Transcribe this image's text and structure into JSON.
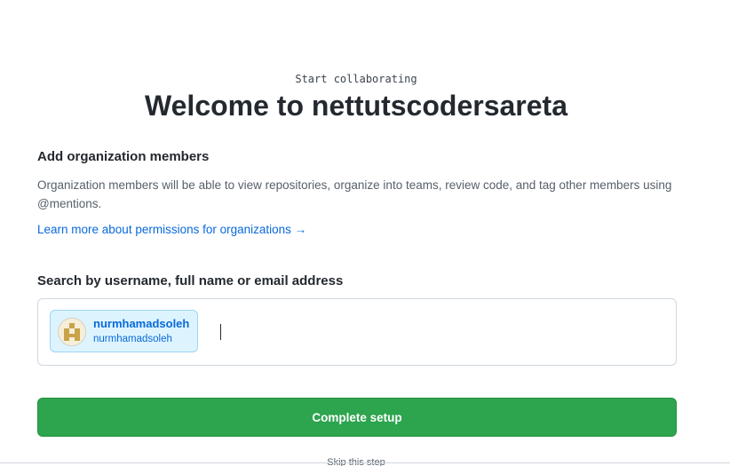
{
  "header": {
    "eyebrow": "Start collaborating",
    "title": "Welcome to nettutscodersareta"
  },
  "members_section": {
    "heading": "Add organization members",
    "description": "Organization members will be able to view repositories, organize into teams, review code, and tag other members using @mentions.",
    "learn_more_link": "Learn more about permissions for organizations →"
  },
  "search": {
    "label": "Search by username, full name or email address",
    "value": "",
    "selected_users": [
      {
        "name": "nurmhamadsoleh",
        "login": "nurmhamadsoleh",
        "avatar_icon": "identicon-avatar",
        "avatar_color": "#c9a24a"
      }
    ]
  },
  "actions": {
    "complete_label": "Complete setup",
    "skip_label": "Skip this step"
  },
  "colors": {
    "primary_button": "#2da44e",
    "link": "#0969da",
    "chip_background": "#ddf4ff"
  }
}
